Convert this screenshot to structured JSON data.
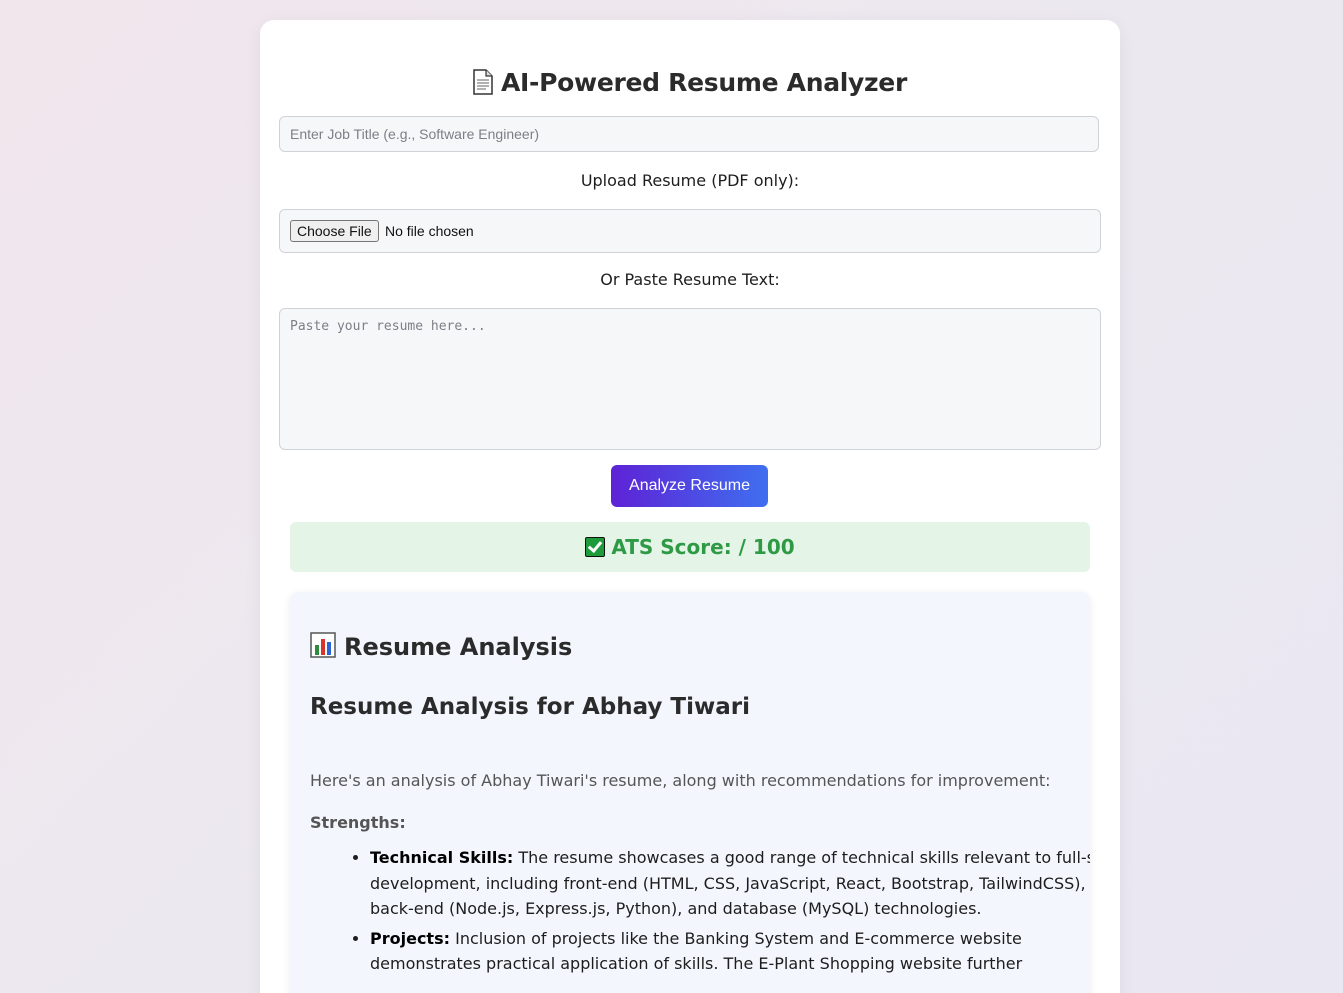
{
  "header": {
    "title": "AI-Powered Resume Analyzer"
  },
  "form": {
    "job_title_placeholder": "Enter Job Title (e.g., Software Engineer)",
    "upload_label": "Upload Resume (PDF only):",
    "choose_file_label": "Choose File",
    "file_status": "No file chosen",
    "paste_label": "Or Paste Resume Text:",
    "resume_placeholder": "Paste your resume here...",
    "analyze_button": "Analyze Resume"
  },
  "ats": {
    "text": "ATS Score: / 100",
    "color": "#2f9a45"
  },
  "analysis": {
    "heading": "Resume Analysis",
    "subheading": "Resume Analysis for Abhay Tiwari",
    "intro": "Here's an analysis of Abhay Tiwari's resume, along with recommendations for improvement:",
    "strengths_label": "Strengths:",
    "items": [
      {
        "label": "Technical Skills:",
        "text": "The resume showcases a good range of technical skills relevant to full-stack development, including front-end (HTML, CSS, JavaScript, React, Bootstrap, TailwindCSS), back-end (Node.js, Express.js, Python), and database (MySQL) technologies."
      },
      {
        "label": "Projects:",
        "text": "Inclusion of projects like the Banking System and E-commerce website demonstrates practical application of skills. The E-Plant Shopping website further"
      }
    ]
  },
  "colors": {
    "button_gradient_start": "#5e22d6",
    "button_gradient_end": "#3f6ff0",
    "ats_background": "#e4f4e6"
  }
}
